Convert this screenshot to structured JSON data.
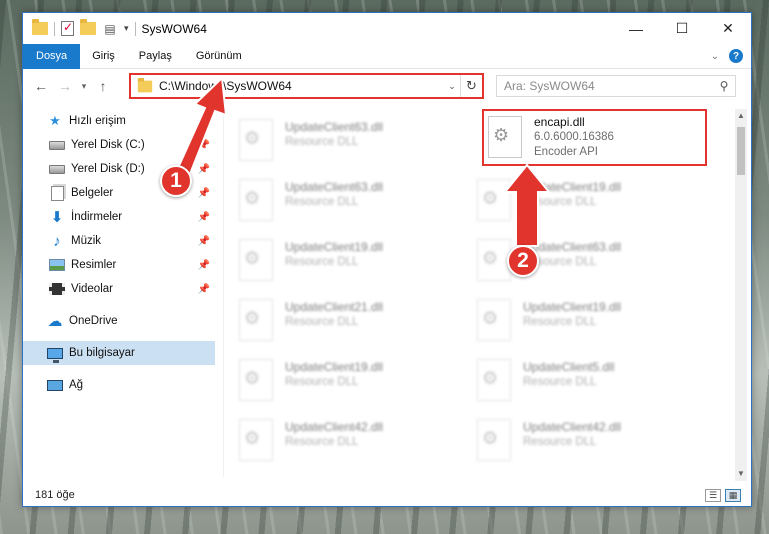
{
  "window": {
    "title": "SysWOW64"
  },
  "titlebar": {
    "minimize_glyph": "—",
    "maximize_glyph": "☐",
    "close_glyph": "✕",
    "qat_dropdown_glyph": "▾"
  },
  "ribbon": {
    "tabs": [
      {
        "label": "Dosya",
        "active": true
      },
      {
        "label": "Giriş"
      },
      {
        "label": "Paylaş"
      },
      {
        "label": "Görünüm"
      }
    ],
    "collapse_glyph": "⌄",
    "help_glyph": "?"
  },
  "navbar": {
    "back_glyph": "←",
    "forward_glyph": "→",
    "recent_glyph": "▾",
    "up_glyph": "↑",
    "address": "C:\\Windows\\SysWOW64",
    "address_dropdown_glyph": "⌄",
    "refresh_glyph": "↻",
    "search_placeholder": "Ara: SysWOW64",
    "search_glyph": "⚲"
  },
  "navpane": {
    "quick_access": "Hızlı erişim",
    "items": [
      {
        "label": "Yerel Disk (C:)",
        "icon": "drive-icon"
      },
      {
        "label": "Yerel Disk (D:)",
        "icon": "drive-icon"
      },
      {
        "label": "Belgeler",
        "icon": "documents-icon"
      },
      {
        "label": "İndirmeler",
        "icon": "downloads-icon"
      },
      {
        "label": "Müzik",
        "icon": "music-icon"
      },
      {
        "label": "Resimler",
        "icon": "pictures-icon"
      },
      {
        "label": "Videolar",
        "icon": "videos-icon"
      }
    ],
    "pin_glyph": "📌",
    "onedrive": "OneDrive",
    "this_pc": "Bu bilgisayar",
    "network": "Ağ",
    "star_glyph": "★",
    "cloud_glyph": "☁",
    "music_glyph": "♪",
    "download_glyph": "🡇"
  },
  "files": {
    "left_column": [
      {
        "name": "UpdateClient63.dll",
        "type": "Resource DLL"
      },
      {
        "name": "UpdateClient63.dll",
        "type": "Resource DLL"
      },
      {
        "name": "UpdateClient19.dll",
        "type": "Resource DLL"
      },
      {
        "name": "UpdateClient21.dll",
        "type": "Resource DLL"
      },
      {
        "name": "UpdateClient19.dll",
        "type": "Resource DLL"
      },
      {
        "name": "UpdateClient42.dll",
        "type": "Resource DLL"
      }
    ],
    "highlighted": {
      "name": "encapi.dll",
      "version": "6.0.6000.16386",
      "description": "Encoder API"
    },
    "right_column": [
      {
        "name": "UpdateClient19.dll",
        "type": "Resource DLL"
      },
      {
        "name": "UpdateClient63.dll",
        "type": "Resource DLL"
      },
      {
        "name": "UpdateClient19.dll",
        "type": "Resource DLL"
      },
      {
        "name": "UpdateClient5.dll",
        "type": "Resource DLL"
      },
      {
        "name": "UpdateClient42.dll",
        "type": "Resource DLL"
      }
    ],
    "gear_glyph": "⚙"
  },
  "scrollbar": {
    "up_glyph": "▲",
    "down_glyph": "▼"
  },
  "status": {
    "item_count": "181 öğe",
    "details_glyph": "☰",
    "tiles_glyph": "▦"
  },
  "annotations": {
    "step1": "1",
    "step2": "2",
    "color": "#e0342c"
  }
}
